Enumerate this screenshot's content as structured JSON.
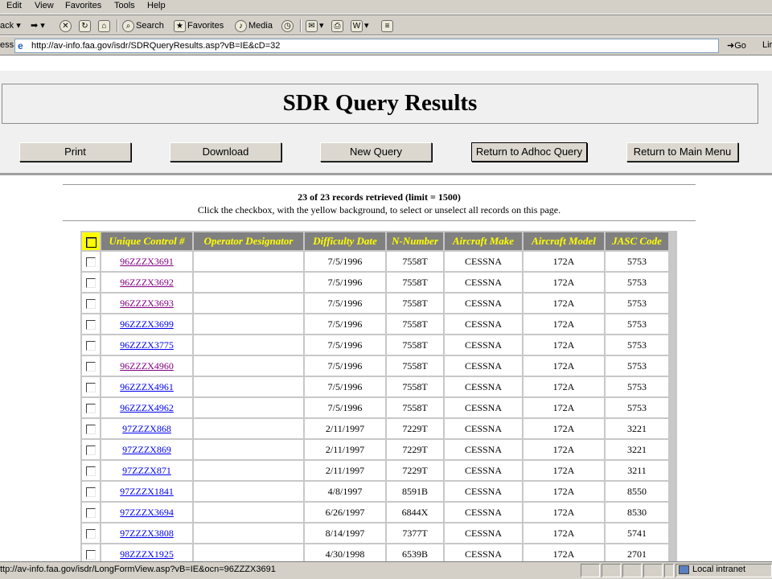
{
  "menubar": {
    "items": [
      "Edit",
      "View",
      "Favorites",
      "Tools",
      "Help"
    ]
  },
  "toolbar": {
    "back_label": "ack",
    "search_label": "Search",
    "favorites_label": "Favorites",
    "media_label": "Media"
  },
  "addressbar": {
    "label": "ess",
    "url": "http://av-info.faa.gov/isdr/SDRQueryResults.asp?vB=IE&cD=32",
    "go_label": "Go",
    "links_label": "Lir"
  },
  "page": {
    "title": "SDR Query Results",
    "buttons": [
      "Print",
      "Download",
      "New Query",
      "Return to Adhoc Query",
      "Return to Main Menu"
    ],
    "records_info": "23 of 23 records retrieved (limit = 1500)",
    "instructions": "Click the checkbox, with the yellow background, to select or unselect all records on this page."
  },
  "table": {
    "columns": [
      "Unique Control #",
      "Operator Designator",
      "Difficulty Date",
      "N-Number",
      "Aircraft Make",
      "Aircraft Model",
      "JASC Code"
    ],
    "rows": [
      {
        "control": "96ZZZX3691",
        "operator": "",
        "date": "7/5/1996",
        "nnumber": "7558T",
        "make": "CESSNA",
        "model": "172A",
        "jasc": "5753",
        "visited": true
      },
      {
        "control": "96ZZZX3692",
        "operator": "",
        "date": "7/5/1996",
        "nnumber": "7558T",
        "make": "CESSNA",
        "model": "172A",
        "jasc": "5753",
        "visited": true
      },
      {
        "control": "96ZZZX3693",
        "operator": "",
        "date": "7/5/1996",
        "nnumber": "7558T",
        "make": "CESSNA",
        "model": "172A",
        "jasc": "5753",
        "visited": true
      },
      {
        "control": "96ZZZX3699",
        "operator": "",
        "date": "7/5/1996",
        "nnumber": "7558T",
        "make": "CESSNA",
        "model": "172A",
        "jasc": "5753",
        "visited": false
      },
      {
        "control": "96ZZZX3775",
        "operator": "",
        "date": "7/5/1996",
        "nnumber": "7558T",
        "make": "CESSNA",
        "model": "172A",
        "jasc": "5753",
        "visited": false
      },
      {
        "control": "96ZZZX4960",
        "operator": "",
        "date": "7/5/1996",
        "nnumber": "7558T",
        "make": "CESSNA",
        "model": "172A",
        "jasc": "5753",
        "visited": true
      },
      {
        "control": "96ZZZX4961",
        "operator": "",
        "date": "7/5/1996",
        "nnumber": "7558T",
        "make": "CESSNA",
        "model": "172A",
        "jasc": "5753",
        "visited": false
      },
      {
        "control": "96ZZZX4962",
        "operator": "",
        "date": "7/5/1996",
        "nnumber": "7558T",
        "make": "CESSNA",
        "model": "172A",
        "jasc": "5753",
        "visited": false
      },
      {
        "control": "97ZZZX868",
        "operator": "",
        "date": "2/11/1997",
        "nnumber": "7229T",
        "make": "CESSNA",
        "model": "172A",
        "jasc": "3221",
        "visited": false
      },
      {
        "control": "97ZZZX869",
        "operator": "",
        "date": "2/11/1997",
        "nnumber": "7229T",
        "make": "CESSNA",
        "model": "172A",
        "jasc": "3221",
        "visited": false
      },
      {
        "control": "97ZZZX871",
        "operator": "",
        "date": "2/11/1997",
        "nnumber": "7229T",
        "make": "CESSNA",
        "model": "172A",
        "jasc": "3211",
        "visited": false
      },
      {
        "control": "97ZZZX1841",
        "operator": "",
        "date": "4/8/1997",
        "nnumber": "8591B",
        "make": "CESSNA",
        "model": "172A",
        "jasc": "8550",
        "visited": false
      },
      {
        "control": "97ZZZX3694",
        "operator": "",
        "date": "6/26/1997",
        "nnumber": "6844X",
        "make": "CESSNA",
        "model": "172A",
        "jasc": "8530",
        "visited": false
      },
      {
        "control": "97ZZZX3808",
        "operator": "",
        "date": "8/14/1997",
        "nnumber": "7377T",
        "make": "CESSNA",
        "model": "172A",
        "jasc": "5741",
        "visited": false
      },
      {
        "control": "98ZZZX1925",
        "operator": "",
        "date": "4/30/1998",
        "nnumber": "6539B",
        "make": "CESSNA",
        "model": "172A",
        "jasc": "2701",
        "visited": false
      }
    ]
  },
  "statusbar": {
    "text": "ttp://av-info.faa.gov/isdr/LongFormView.asp?vB=IE&ocn=96ZZZX3691",
    "zone": "Local intranet"
  },
  "colors": {
    "chrome": "#d4d0c8",
    "header_bg": "#808080",
    "header_text": "#ffff00",
    "link": "#0000ee",
    "visited_link": "#800080"
  }
}
